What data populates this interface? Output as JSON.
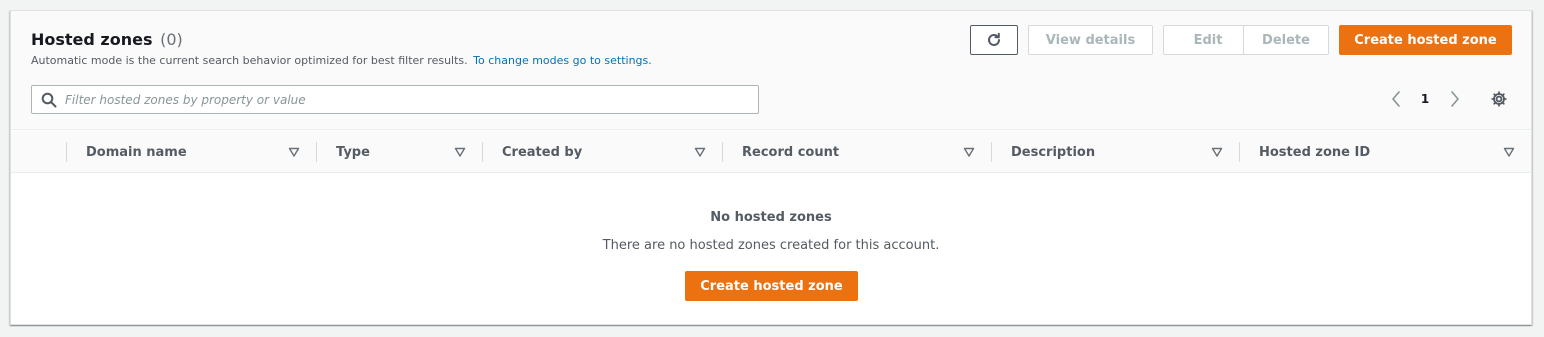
{
  "header": {
    "title": "Hosted zones",
    "count": "(0)",
    "description": "Automatic mode is the current search behavior optimized for best filter results.",
    "settings_link": "To change modes go to settings."
  },
  "toolbar": {
    "refresh_icon": "refresh-icon",
    "view_details": "View details",
    "edit": "Edit",
    "delete": "Delete",
    "create": "Create hosted zone"
  },
  "search": {
    "placeholder": "Filter hosted zones by property or value",
    "value": ""
  },
  "pagination": {
    "current_page": "1"
  },
  "table": {
    "columns": [
      {
        "label": "Domain name"
      },
      {
        "label": "Type"
      },
      {
        "label": "Created by"
      },
      {
        "label": "Record count"
      },
      {
        "label": "Description"
      },
      {
        "label": "Hosted zone ID"
      }
    ]
  },
  "empty_state": {
    "title": "No hosted zones",
    "description": "There are no hosted zones created for this account.",
    "button": "Create hosted zone"
  },
  "colors": {
    "primary": "#ec7211",
    "link": "#0073bb",
    "page_bg": "#f2f3f3"
  }
}
